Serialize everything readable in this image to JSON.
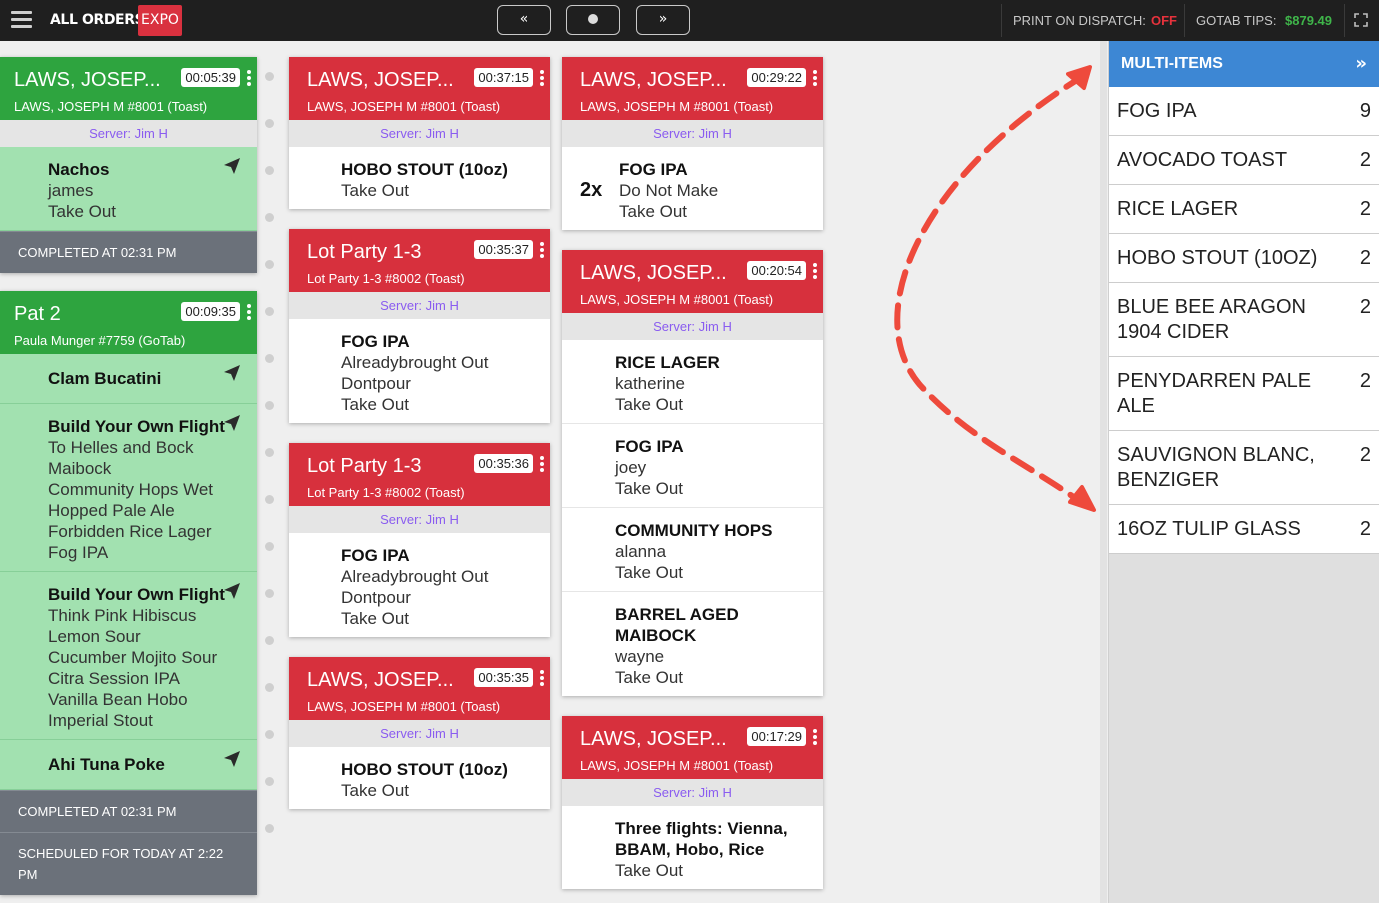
{
  "topbar": {
    "title": "ALL ORDERS",
    "badge": "EXPO",
    "nav_prev": "«",
    "nav_next": "»",
    "print_label": "PRINT ON DISPATCH:",
    "print_value": "OFF",
    "tips_label": "GOTAB TIPS:",
    "tips_value": "$879.49",
    "colors": {
      "off": "#e6323c",
      "tips": "#3fb54a"
    }
  },
  "col1": [
    {
      "name": "LAWS, JOSEP...",
      "sub": "LAWS, JOSEPH M #8001 (Toast)",
      "timer": "00:05:39",
      "server": "Server: Jim H",
      "items": [
        {
          "title": "Nachos",
          "lines": [
            "james",
            "Take Out"
          ]
        }
      ],
      "status": [
        "COMPLETED AT 02:31 PM"
      ]
    },
    {
      "name": "Pat 2",
      "sub": "Paula Munger #7759 (GoTab)",
      "timer": "00:09:35",
      "items": [
        {
          "title": "Clam Bucatini",
          "lines": []
        },
        {
          "title": "Build Your Own Flight",
          "lines": [
            "To Helles and Bock",
            "Maibock",
            "Community Hops Wet",
            "Hopped Pale Ale",
            "Forbidden Rice Lager",
            "Fog IPA"
          ]
        },
        {
          "title": "Build Your Own Flight",
          "lines": [
            "Think Pink Hibiscus",
            "Lemon Sour",
            "Cucumber Mojito Sour",
            "Citra Session IPA",
            "Vanilla Bean Hobo",
            "Imperial Stout"
          ]
        },
        {
          "title": "Ahi Tuna Poke",
          "lines": []
        }
      ],
      "status": [
        "COMPLETED AT 02:31 PM",
        "SCHEDULED FOR TODAY AT 2:22 PM"
      ]
    }
  ],
  "col2": [
    {
      "name": "LAWS, JOSEP...",
      "sub": "LAWS, JOSEPH M #8001 (Toast)",
      "timer": "00:37:15",
      "server": "Server: Jim H",
      "items": [
        {
          "title": "HOBO STOUT (10oz)",
          "lines": [
            "Take Out"
          ]
        }
      ]
    },
    {
      "name": "Lot Party 1-3",
      "sub": "Lot Party 1-3 #8002 (Toast)",
      "timer": "00:35:37",
      "server": "Server: Jim H",
      "items": [
        {
          "title": "FOG IPA",
          "lines": [
            "Alreadybrought Out",
            "Dontpour",
            "Take Out"
          ]
        }
      ]
    },
    {
      "name": "Lot Party 1-3",
      "sub": "Lot Party 1-3 #8002 (Toast)",
      "timer": "00:35:36",
      "server": "Server: Jim H",
      "items": [
        {
          "title": "FOG IPA",
          "lines": [
            "Alreadybrought Out",
            "Dontpour",
            "Take Out"
          ]
        }
      ]
    },
    {
      "name": "LAWS, JOSEP...",
      "sub": "LAWS, JOSEPH M #8001 (Toast)",
      "timer": "00:35:35",
      "server": "Server: Jim H",
      "items": [
        {
          "title": "HOBO STOUT (10oz)",
          "lines": [
            "Take Out"
          ]
        }
      ]
    }
  ],
  "col3": [
    {
      "name": "LAWS, JOSEP...",
      "sub": "LAWS, JOSEPH M #8001 (Toast)",
      "timer": "00:29:22",
      "server": "Server: Jim H",
      "items": [
        {
          "qty": "2x",
          "title": "FOG IPA",
          "lines": [
            "Do Not Make",
            "Take Out"
          ]
        }
      ]
    },
    {
      "name": "LAWS, JOSEP...",
      "sub": "LAWS, JOSEPH M #8001 (Toast)",
      "timer": "00:20:54",
      "server": "Server: Jim H",
      "items": [
        {
          "title": "RICE LAGER",
          "lines": [
            "katherine",
            "Take Out"
          ]
        },
        {
          "title": "FOG IPA",
          "lines": [
            "joey",
            "Take Out"
          ]
        },
        {
          "title": "COMMUNITY HOPS",
          "lines": [
            "alanna",
            "Take Out"
          ]
        },
        {
          "title": "BARREL AGED MAIBOCK",
          "lines": [
            "wayne",
            "Take Out"
          ]
        }
      ]
    },
    {
      "name": "LAWS, JOSEP...",
      "sub": "LAWS, JOSEPH M #8001 (Toast)",
      "timer": "00:17:29",
      "server": "Server: Jim H",
      "items": [
        {
          "title": "Three flights: Vienna, BBAM, Hobo, Rice",
          "lines": [
            "Take Out"
          ]
        }
      ]
    }
  ],
  "multi_items": {
    "title": "MULTI-ITEMS",
    "collapse": "»",
    "rows": [
      {
        "name": "FOG IPA",
        "count": "9"
      },
      {
        "name": "AVOCADO TOAST",
        "count": "2"
      },
      {
        "name": "RICE LAGER",
        "count": "2"
      },
      {
        "name": "HOBO STOUT (10OZ)",
        "count": "2"
      },
      {
        "name": "BLUE BEE ARAGON 1904 CIDER",
        "count": "2"
      },
      {
        "name": "PENYDARREN PALE ALE",
        "count": "2"
      },
      {
        "name": "SAUVIGNON BLANC, BENZIGER",
        "count": "2"
      },
      {
        "name": "16OZ TULIP GLASS",
        "count": "2"
      }
    ]
  }
}
